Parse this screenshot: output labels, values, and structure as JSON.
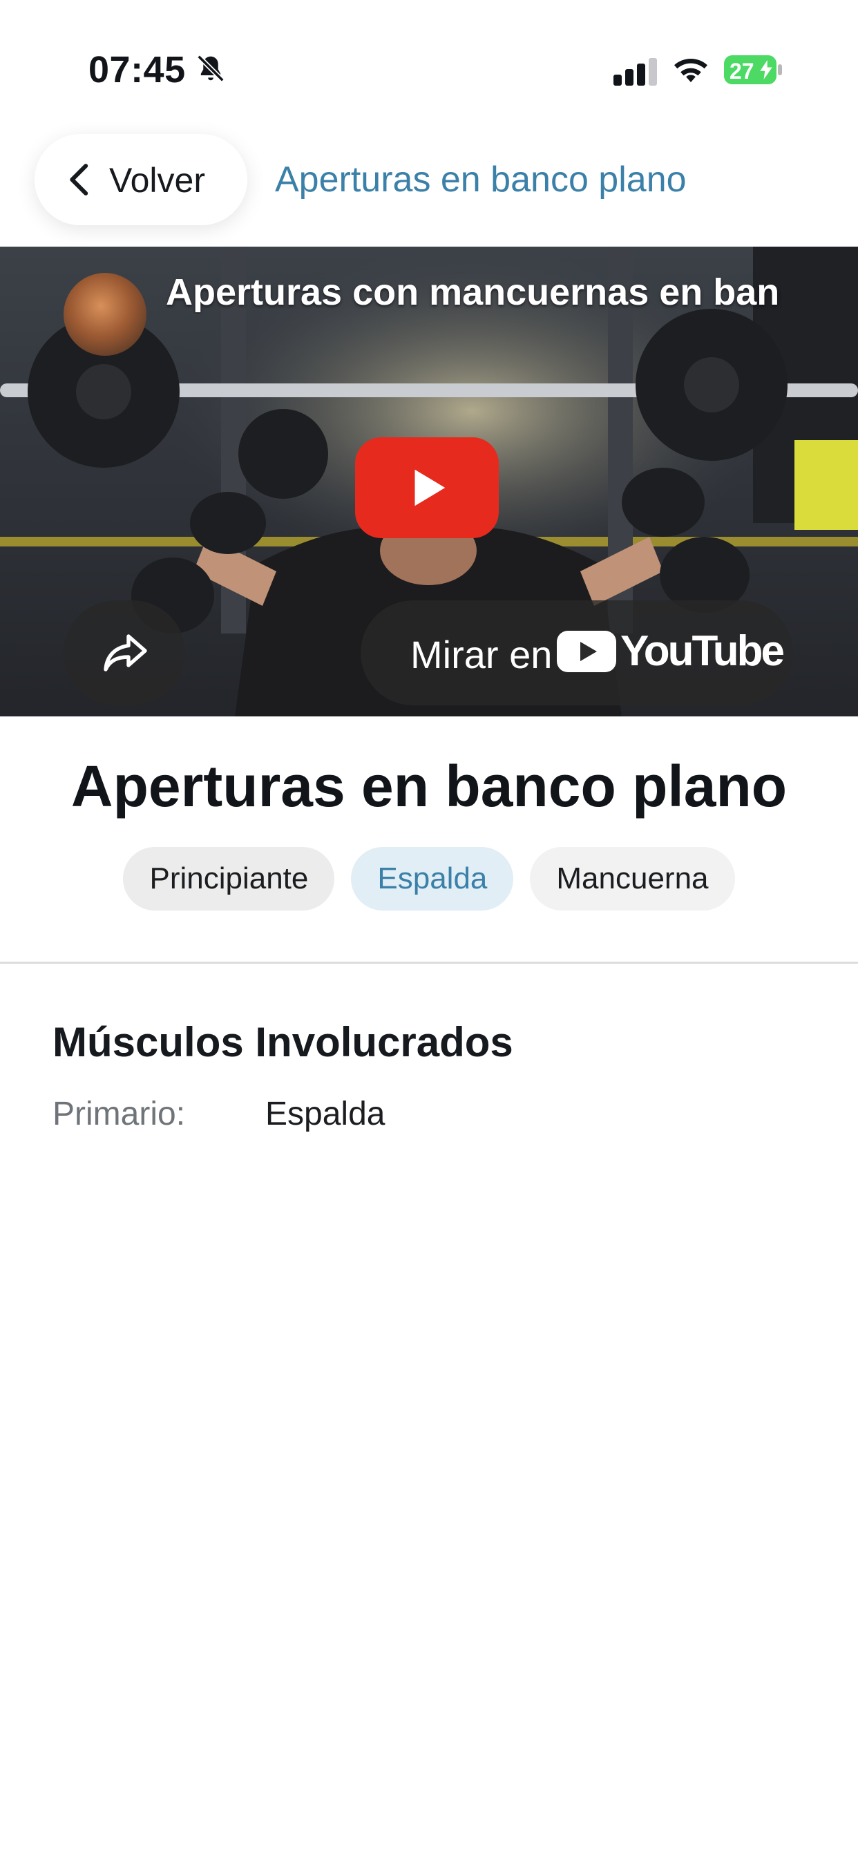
{
  "status_bar": {
    "time": "07:45",
    "battery": "27"
  },
  "nav": {
    "back_label": "Volver",
    "title": "Aperturas en banco plano"
  },
  "video": {
    "title": "Aperturas con mancuernas en banco plano",
    "watch_on_label": "Mirar en",
    "platform": "YouTube"
  },
  "exercise": {
    "title": "Aperturas en banco plano",
    "tags": {
      "level": "Principiante",
      "muscle": "Espalda",
      "equipment": "Mancuerna"
    }
  },
  "muscles": {
    "section_title": "Músculos Involucrados",
    "primary_label": "Primario:",
    "primary_value": "Espalda"
  },
  "colors": {
    "accent": "#3b80a8",
    "youtube_red": "#e62b1e",
    "battery_green": "#4cd964"
  }
}
